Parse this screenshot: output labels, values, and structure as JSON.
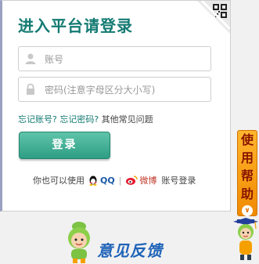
{
  "login": {
    "title": "进入平台请登录",
    "username_placeholder": "账号",
    "password_placeholder": "密码(注意字母区分大小写)",
    "forgot_account": "忘记账号?",
    "forgot_password": "忘记密码?",
    "other_questions": "其他常见问题",
    "login_button": "登录",
    "third_party_prefix": "你也可以使用",
    "qq_label": "QQ",
    "separator": "|",
    "weibo_label": "微博",
    "account_login": "账号登录"
  },
  "help": {
    "chars": [
      "使",
      "用",
      "帮",
      "助"
    ],
    "expand_glyph": "∨"
  },
  "feedback": {
    "label": "意见反馈"
  },
  "colors": {
    "brand_green": "#137a72",
    "button_green": "#3aa98e",
    "help_orange": "#f5a000",
    "feedback_blue": "#1f63b8"
  }
}
